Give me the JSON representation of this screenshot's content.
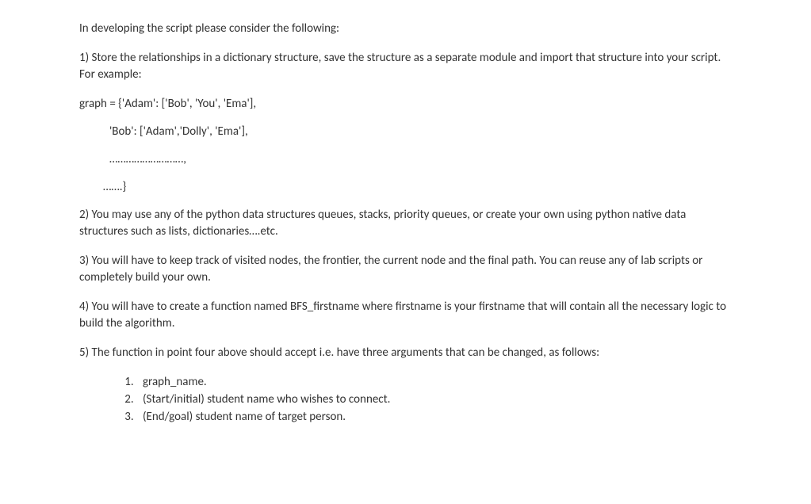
{
  "intro": "In developing the script please consider the following:",
  "point1": "1) Store the relationships in a dictionary structure, save the structure as a separate module and import that structure into your script. For example:",
  "code": {
    "line1": "graph = {'Adam': ['Bob', 'You', 'Ema'],",
    "line2": "'Bob': ['Adam','Dolly', 'Ema'],",
    "line3": "………………………,",
    "line4": "…….}"
  },
  "point2": "2) You may use any of the python data structures queues, stacks, priority queues, or create your own using python native data structures such as lists, dictionaries….etc.",
  "point3": "3) You will have to keep track of visited nodes, the frontier, the current node and the final path. You can reuse any of lab scripts or completely build your own.",
  "point4": "4) You will have to create a function named BFS_firstname where firstname is your firstname that will contain all the necessary logic to build the algorithm.",
  "point5": "5) The function in point four above should accept i.e. have three arguments that can be changed, as follows:",
  "args": {
    "a1": "graph_name.",
    "a2": "(Start/initial) student name who wishes to connect.",
    "a3": "(End/goal) student name of target person."
  }
}
